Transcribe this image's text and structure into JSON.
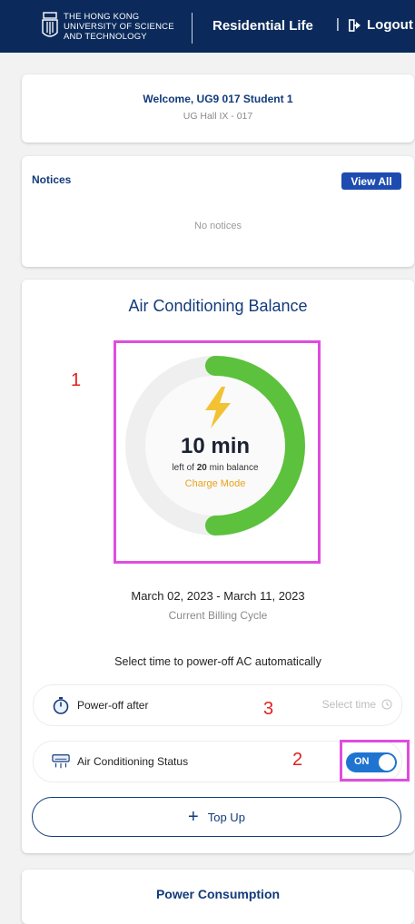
{
  "header": {
    "logo_lines": [
      "THE HONG KONG",
      "UNIVERSITY OF SCIENCE",
      "AND TECHNOLOGY"
    ],
    "title": "Residential Life",
    "separator": "|",
    "logout_label": "Logout",
    "logout_icon": "logout-icon"
  },
  "welcome": {
    "greeting": "Welcome, UG9 017 Student 1",
    "hall": "UG Hall IX - 017"
  },
  "notices": {
    "title": "Notices",
    "view_all_label": "View All",
    "empty_text": "No notices"
  },
  "ac": {
    "title": "Air Conditioning Balance",
    "minutes_left_label": "10 min",
    "balance_prefix": "left of ",
    "balance_total": "20",
    "balance_suffix": " min balance",
    "remaining_fraction": 0.5,
    "mode": "Charge Mode",
    "billing_dates": "March 02, 2023 - March 11, 2023",
    "billing_label": "Current Billing Cycle",
    "select_prompt": "Select time to power-off AC automatically",
    "power_off_label": "Power-off after",
    "select_time_placeholder": "Select time",
    "status_label": "Air Conditioning Status",
    "toggle_label": "ON",
    "toggle_state": true,
    "top_up_label": "Top Up",
    "annotations": [
      "1",
      "2",
      "3"
    ],
    "colors": {
      "gauge_fill": "#5cc13c",
      "gauge_track": "#efefef",
      "mode": "#e9a21b",
      "toggle": "#1f74d0",
      "highlight": "#e04ce0",
      "annotation": "#e02020"
    }
  },
  "power": {
    "title": "Power Consumption"
  }
}
